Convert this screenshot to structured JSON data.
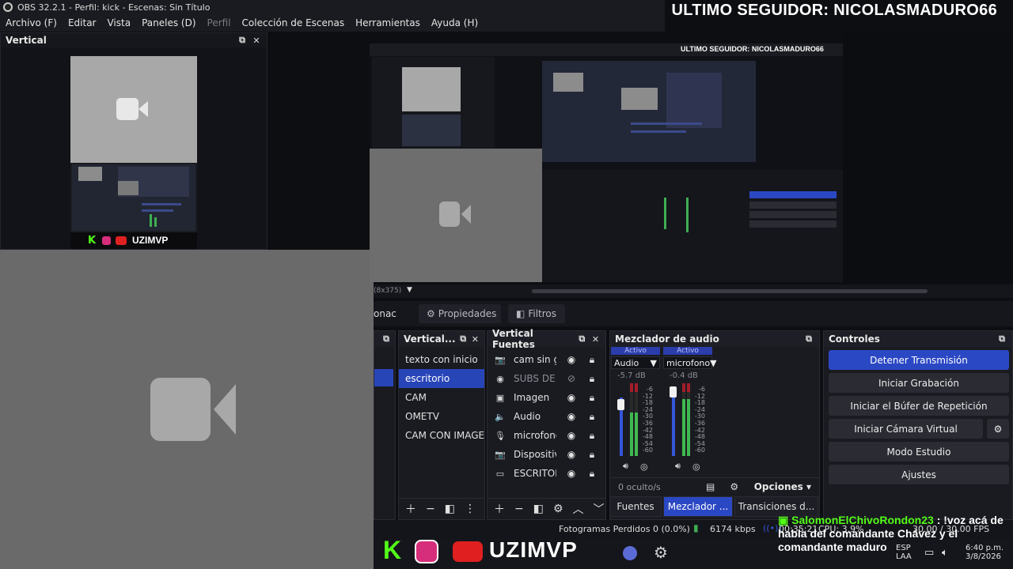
{
  "window": {
    "title": "OBS 32.2.1 - Perfil: kick - Escenas: Sin Título"
  },
  "menu": [
    "Archivo (F)",
    "Editar",
    "Vista",
    "Paneles (D)",
    "Perfil",
    "Colección de Escenas",
    "Herramientas",
    "Ayuda (H)"
  ],
  "overlay": {
    "follower": "ULTIMO SEGUIDOR: NICOLASMADURO66",
    "brand": "UZIMVP",
    "nested_follower": "ULTIMO SEGUIDOR: NICOLASMADURO66"
  },
  "vertical_dock": {
    "title": "Vertical"
  },
  "preview": {
    "resolution": "(8x375)"
  },
  "props": {
    "label_left": "onac",
    "properties": "Propiedades",
    "filters": "Filtros"
  },
  "scenes_panel": {
    "title": "Vertical...",
    "items": [
      "texto con inicio",
      "escritorio",
      "CAM",
      "OMETV",
      "CAM CON IMAGEN"
    ],
    "selected": 1
  },
  "sources_panel": {
    "title": "Vertical Fuentes",
    "items": [
      {
        "icon": "camera-icon",
        "glyph": "📷",
        "name": "cam sin gr",
        "visible": true
      },
      {
        "icon": "browser-icon",
        "glyph": "◉",
        "name": "SUBS DE Y",
        "visible": false
      },
      {
        "icon": "image-icon",
        "glyph": "▣",
        "name": "Imagen",
        "visible": true
      },
      {
        "icon": "speaker-icon",
        "glyph": "🔈",
        "name": "Audio",
        "visible": true
      },
      {
        "icon": "microphone-icon",
        "glyph": "🎙",
        "name": "microfono",
        "visible": true
      },
      {
        "icon": "camera-icon",
        "glyph": "📷",
        "name": "Dispositiv",
        "visible": true
      },
      {
        "icon": "monitor-icon",
        "glyph": "▭",
        "name": "ESCRITOR",
        "visible": true
      }
    ]
  },
  "mixer": {
    "title": "Mezclador de audio",
    "channels": [
      {
        "active": "Activo",
        "name": "Audio",
        "db": "-5.7 dB",
        "level": 0.7
      },
      {
        "active": "Activo",
        "name": "microfono",
        "db": "-0.4 dB",
        "level": 0.92
      }
    ],
    "scale": [
      "-6",
      "-12",
      "-18",
      "-24",
      "-30",
      "-36",
      "-42",
      "-48",
      "-54",
      "-60"
    ],
    "hidden": "0 oculto/s",
    "options": "Opciones"
  },
  "controls": {
    "title": "Controles",
    "buttons": [
      "Detener Transmisión",
      "Iniciar Grabación",
      "Iniciar el Búfer de Repetición",
      "Iniciar Cámara Virtual",
      "Modo Estudio",
      "Ajustes"
    ]
  },
  "bottom_tabs": [
    "Fuentes",
    "Mezclador ...",
    "Transiciones d..."
  ],
  "status": {
    "dropped": "Fotogramas Perdidos 0 (0.0%)",
    "kbps": "6174 kbps",
    "time": "00:35:21",
    "cpu": "CPU: 3.9%",
    "fps": "30.00 / 30.00 FPS"
  },
  "chat": {
    "user": "SalomonElChivoRondon23",
    "message": ": !voz acá de habla del comandante Chávez y el comandante maduro"
  },
  "tray": {
    "lang": "ESP",
    "layout": "LAA",
    "clock": "6:40 p.m.",
    "date": "3/8/2026"
  },
  "colors": {
    "accent": "#2b48c4",
    "kick_green": "#53fc18",
    "panel": "#1a1b21"
  }
}
